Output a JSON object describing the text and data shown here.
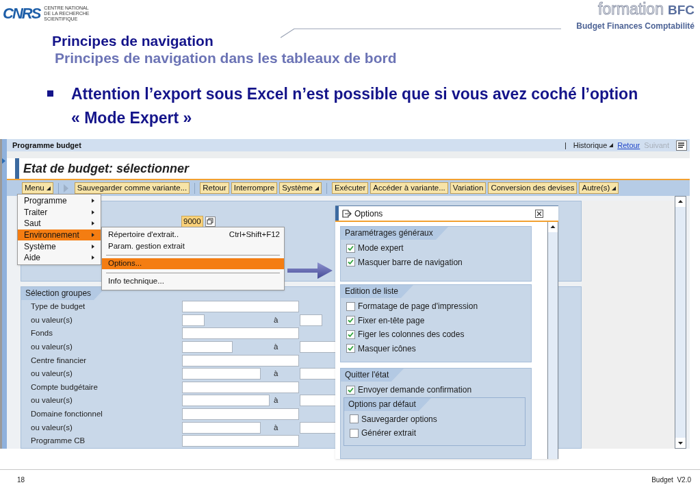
{
  "header": {
    "logo": "CNRS",
    "logo_caption": [
      "CENTRE NATIONAL",
      "DE LA RECHERCHE",
      "SCIENTIFIQUE"
    ],
    "brand": "formation",
    "brand_accent": "BFC",
    "brand_sub": "Budget Finances Comptabilité"
  },
  "title": "Principes de navigation",
  "subtitle": "Principes de navigation dans les tableaux de bord",
  "bullets": [
    "Attention l’export sous Excel n’est possible que si vous avez coché l’option « Mode Expert »"
  ],
  "sap": {
    "window_title": "Programme budget",
    "nav_divider": "|",
    "history": "Historique",
    "nav_links": [
      {
        "label": "Retour",
        "disabled": false
      },
      {
        "label": "Suivant",
        "disabled": true
      }
    ],
    "page_title": "Etat de budget: sélectionner",
    "toolbar": [
      {
        "kind": "dropdown",
        "label": "Menu"
      },
      {
        "kind": "separator"
      },
      {
        "kind": "nav"
      },
      {
        "kind": "button",
        "label": "Sauvegarder comme variante..."
      },
      {
        "kind": "separator"
      },
      {
        "kind": "button",
        "label": "Retour"
      },
      {
        "kind": "button",
        "label": "Interrompre"
      },
      {
        "kind": "dropdown",
        "label": "Système"
      },
      {
        "kind": "separator"
      },
      {
        "kind": "button",
        "label": "Exécuter"
      },
      {
        "kind": "button",
        "label": "Accéder à variante..."
      },
      {
        "kind": "button",
        "label": "Variation"
      },
      {
        "kind": "button",
        "label": "Conversion des devises"
      },
      {
        "kind": "dropdown",
        "label": "Autre(s)"
      }
    ],
    "value_field": "9000",
    "selection": {
      "title": "Sélection groupes",
      "rows": [
        {
          "kind": "single",
          "label": "Type de budget"
        },
        {
          "kind": "range",
          "label": "ou valeur(s)",
          "to": "à"
        },
        {
          "kind": "single",
          "label": "Fonds"
        },
        {
          "kind": "range",
          "label": "ou valeur(s)",
          "to": "à"
        },
        {
          "kind": "single",
          "label": "Centre financier"
        },
        {
          "kind": "range",
          "label": "ou valeur(s)",
          "to": "à"
        },
        {
          "kind": "single",
          "label": "Compte budgétaire"
        },
        {
          "kind": "range",
          "label": "ou valeur(s)",
          "to": "à"
        },
        {
          "kind": "single",
          "label": "Domaine fonctionnel"
        },
        {
          "kind": "range",
          "label": "ou valeur(s)",
          "to": "à"
        },
        {
          "kind": "single",
          "label": "Programme CB"
        }
      ]
    },
    "menu": {
      "items": [
        {
          "label": "Programme",
          "selected": false
        },
        {
          "label": "Traiter",
          "selected": false
        },
        {
          "label": "Saut",
          "selected": false
        },
        {
          "label": "Environnement",
          "selected": true
        },
        {
          "label": "Système",
          "selected": false
        },
        {
          "label": "Aide",
          "selected": false
        }
      ]
    },
    "submenu": {
      "items": [
        {
          "kind": "item",
          "label": "Répertoire d'extrait..",
          "shortcut": "Ctrl+Shift+F12",
          "selected": false
        },
        {
          "kind": "item",
          "label": "Param. gestion extrait",
          "selected": false
        },
        {
          "kind": "separator"
        },
        {
          "kind": "item",
          "label": "Options...",
          "selected": true
        },
        {
          "kind": "separator"
        },
        {
          "kind": "item",
          "label": "Info technique...",
          "selected": false
        }
      ]
    },
    "dialog": {
      "title": "Options",
      "sections": [
        {
          "title": "Paramétrages généraux",
          "options": [
            {
              "label": "Mode expert",
              "checked": true
            },
            {
              "label": "Masquer barre de navigation",
              "checked": true
            }
          ]
        },
        {
          "title": "Edition de liste",
          "options": [
            {
              "label": "Formatage de page d'impression",
              "checked": false
            },
            {
              "label": "Fixer en-tête page",
              "checked": true
            },
            {
              "label": "Figer les colonnes des codes",
              "checked": true
            },
            {
              "label": "Masquer icônes",
              "checked": true
            }
          ]
        },
        {
          "title": "Quitter l'état",
          "options": [
            {
              "label": "Envoyer demande confirmation",
              "checked": true
            }
          ],
          "subgroup": {
            "title": "Options par défaut",
            "options": [
              {
                "label": "Sauvegarder options",
                "checked": false
              },
              {
                "label": "Générer extrait",
                "checked": false
              }
            ]
          }
        }
      ]
    }
  },
  "footer": {
    "page": "18",
    "doc": "Budget  V2.0"
  }
}
